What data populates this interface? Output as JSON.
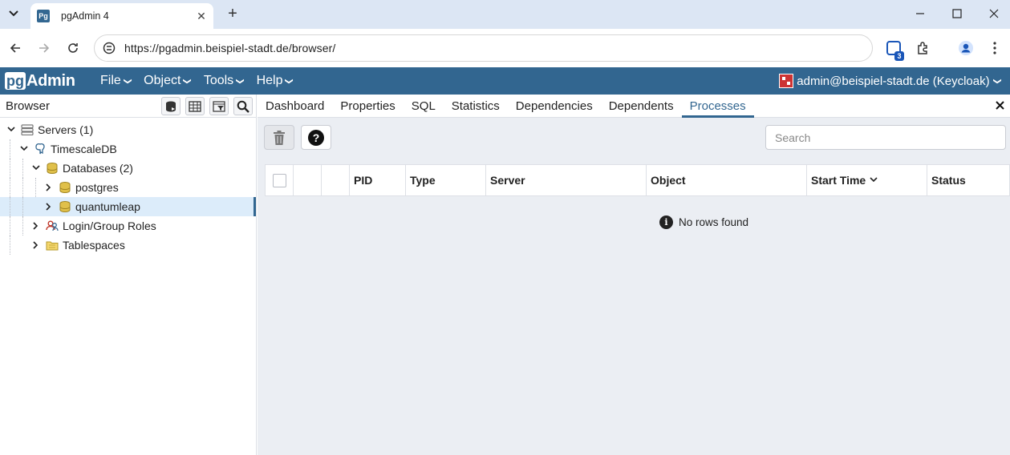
{
  "browser": {
    "tab_title": "pgAdmin 4",
    "favicon_text": "Pg",
    "url": "https://pgadmin.beispiel-stadt.de/browser/",
    "extension_badge_count": "3"
  },
  "app": {
    "logo_pg": "pg",
    "logo_admin": "Admin",
    "menu": [
      "File",
      "Object",
      "Tools",
      "Help"
    ],
    "user": "admin@beispiel-stadt.de (Keycloak)"
  },
  "browser_panel": {
    "title": "Browser",
    "tree": [
      {
        "label": "Servers (1)",
        "icon": "servers-icon"
      },
      {
        "label": "TimescaleDB",
        "icon": "elephant-server-icon"
      },
      {
        "label": "Databases (2)",
        "icon": "databases-icon"
      },
      {
        "label": "postgres",
        "icon": "database-icon"
      },
      {
        "label": "quantumleap",
        "icon": "database-icon"
      },
      {
        "label": "Login/Group Roles",
        "icon": "roles-icon"
      },
      {
        "label": "Tablespaces",
        "icon": "tablespaces-icon"
      }
    ]
  },
  "content": {
    "tabs": [
      "Dashboard",
      "Properties",
      "SQL",
      "Statistics",
      "Dependencies",
      "Dependents",
      "Processes"
    ],
    "active_tab": "Processes",
    "search_placeholder": "Search",
    "columns": [
      "PID",
      "Type",
      "Server",
      "Object",
      "Start Time",
      "Status"
    ],
    "empty_message": "No rows found"
  },
  "colors": {
    "brand": "#326690",
    "selected_row": "#dcecfa",
    "panel_bg": "#ebeef3"
  }
}
